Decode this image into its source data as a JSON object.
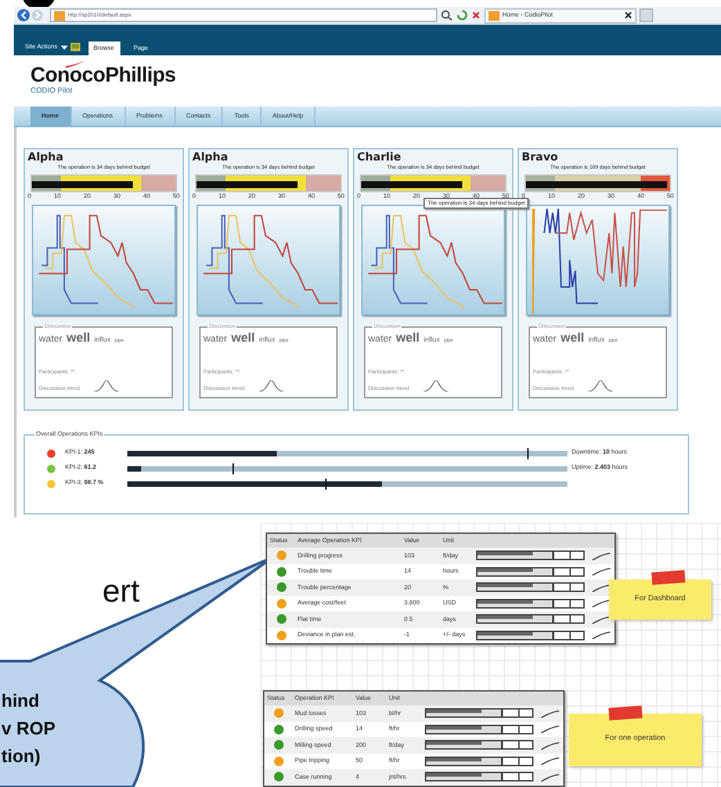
{
  "browser": {
    "address": "http://sp2010/default.aspx",
    "tab_title": "Home - CodioPilot"
  },
  "ribbon": {
    "site_actions": "Site Actions",
    "tabs": [
      {
        "label": "Browse",
        "selected": true
      },
      {
        "label": "Page",
        "selected": false
      }
    ]
  },
  "header": {
    "logo": "ConocoPhillips",
    "subtitle": "CODIO Pilot"
  },
  "nav": [
    {
      "label": "Home",
      "selected": true
    },
    {
      "label": "Operations",
      "selected": false
    },
    {
      "label": "Problems",
      "selected": false
    },
    {
      "label": "Contacts",
      "selected": false
    },
    {
      "label": "Tools",
      "selected": false
    },
    {
      "label": "About/Help",
      "selected": false
    }
  ],
  "cards": [
    {
      "title": "Alpha",
      "caption": "The operation is 34 days behind budget",
      "kind": "warning",
      "level": 0.7,
      "ticks": [
        "0",
        "10",
        "20",
        "30",
        "40",
        "50"
      ],
      "discussion": {
        "legend": "Discussion",
        "words": [
          {
            "text": "water",
            "kind": "medium"
          },
          {
            "text": "well",
            "kind": "large"
          },
          {
            "text": "influx",
            "kind": "small"
          },
          {
            "text": "pipe",
            "kind": "tiny"
          }
        ],
        "participants": "Participants: **",
        "trend": "Discussion trend"
      }
    },
    {
      "title": "Alpha",
      "caption": "The operation is 34 days behind budget",
      "kind": "warning",
      "level": 0.7,
      "ticks": [
        "0",
        "10",
        "20",
        "30",
        "40",
        "50"
      ],
      "discussion": {
        "legend": "Discussion",
        "words": [
          {
            "text": "water",
            "kind": "medium"
          },
          {
            "text": "well",
            "kind": "large"
          },
          {
            "text": "influx",
            "kind": "small"
          },
          {
            "text": "pipe",
            "kind": "tiny"
          }
        ],
        "participants": "Participants: **",
        "trend": "Discussion trend"
      }
    },
    {
      "title": "Charlie",
      "caption": "The operation is 34 days behind budget",
      "kind": "warning",
      "level": 0.7,
      "ticks": [
        "0",
        "10",
        "20",
        "30",
        "40",
        "50"
      ],
      "discussion": {
        "legend": "Discussion",
        "words": [
          {
            "text": "water",
            "kind": "medium"
          },
          {
            "text": "well",
            "kind": "large"
          },
          {
            "text": "influx",
            "kind": "small"
          },
          {
            "text": "pipe",
            "kind": "tiny"
          }
        ],
        "participants": "Participants: **",
        "trend": "Discussion trend"
      }
    },
    {
      "title": "Bravo",
      "caption": "The operation is 169 days behind budget",
      "kind": "critical",
      "level": 0.98,
      "ticks": [
        "0",
        "10",
        "20",
        "30",
        "40",
        "50"
      ],
      "discussion": {
        "legend": "Discussion",
        "words": [
          {
            "text": "water",
            "kind": "medium"
          },
          {
            "text": "well",
            "kind": "large"
          },
          {
            "text": "influx",
            "kind": "small"
          },
          {
            "text": "pipe",
            "kind": "tiny"
          }
        ],
        "participants": "Participants: **",
        "trend": "Discussion trend"
      }
    }
  ],
  "tooltip": "The operation is 34 days behind budget",
  "kpis": {
    "legend": "Overall Operations KPIs",
    "rows": [
      {
        "color": "#e8412c",
        "label": "KPI-1: **245**",
        "level": 0.34,
        "target": {
          "level": 0.91
        },
        "note": "Downtime: **10** hours"
      },
      {
        "color": "#7cc242",
        "label": "KPI-2: **61.2**",
        "level": 0.03,
        "target": {
          "level": 0.24
        },
        "note": "Uptime: **2.403** hours"
      },
      {
        "color": "#f7c531",
        "label": "KPI-3: **98.7 %**",
        "level": 0.58,
        "target": {
          "level": 0.45
        }
      }
    ]
  },
  "slide_text": "ert",
  "callout": {
    "lines": [
      "hind",
      "v ROP",
      "tion)"
    ]
  },
  "tables": [
    {
      "columns": [
        "Status",
        "Average Operation KPI",
        "Value",
        "Unit"
      ],
      "rows": [
        {
          "color": "#f0a020",
          "name": "Drilling progress",
          "value": "103",
          "unit": "ft/day"
        },
        {
          "color": "#3a9a2a",
          "name": "Trouble time",
          "value": "14",
          "unit": "hours"
        },
        {
          "color": "#3a9a2a",
          "name": "Trouble percentage",
          "value": "20",
          "unit": "%"
        },
        {
          "color": "#f0a020",
          "name": "Average cost/feet",
          "value": "3.800",
          "unit": "USD"
        },
        {
          "color": "#3a9a2a",
          "name": "Flat time",
          "value": "0.5",
          "unit": "days"
        },
        {
          "color": "#f0a020",
          "name": "Deviance in plan est.",
          "value": "-1",
          "unit": "+/- days"
        }
      ]
    },
    {
      "columns": [
        "Status",
        "Operation KPI",
        "Value",
        "Unit"
      ],
      "rows": [
        {
          "color": "#f0a020",
          "name": "Mud losses",
          "value": "103",
          "unit": "bl/hr"
        },
        {
          "color": "#3a9a2a",
          "name": "Drilling speed",
          "value": "14",
          "unit": "ft/hr"
        },
        {
          "color": "#3a9a2a",
          "name": "Milling speed",
          "value": "200",
          "unit": "ft/day"
        },
        {
          "color": "#f0a020",
          "name": "Pipe tripping",
          "value": "50",
          "unit": "ft/hr"
        },
        {
          "color": "#3a9a2a",
          "name": "Case running",
          "value": "4",
          "unit": "jnt/hrs"
        }
      ]
    }
  ],
  "notes": [
    {
      "text": "For Dashboard"
    },
    {
      "text": "For one operation"
    }
  ]
}
